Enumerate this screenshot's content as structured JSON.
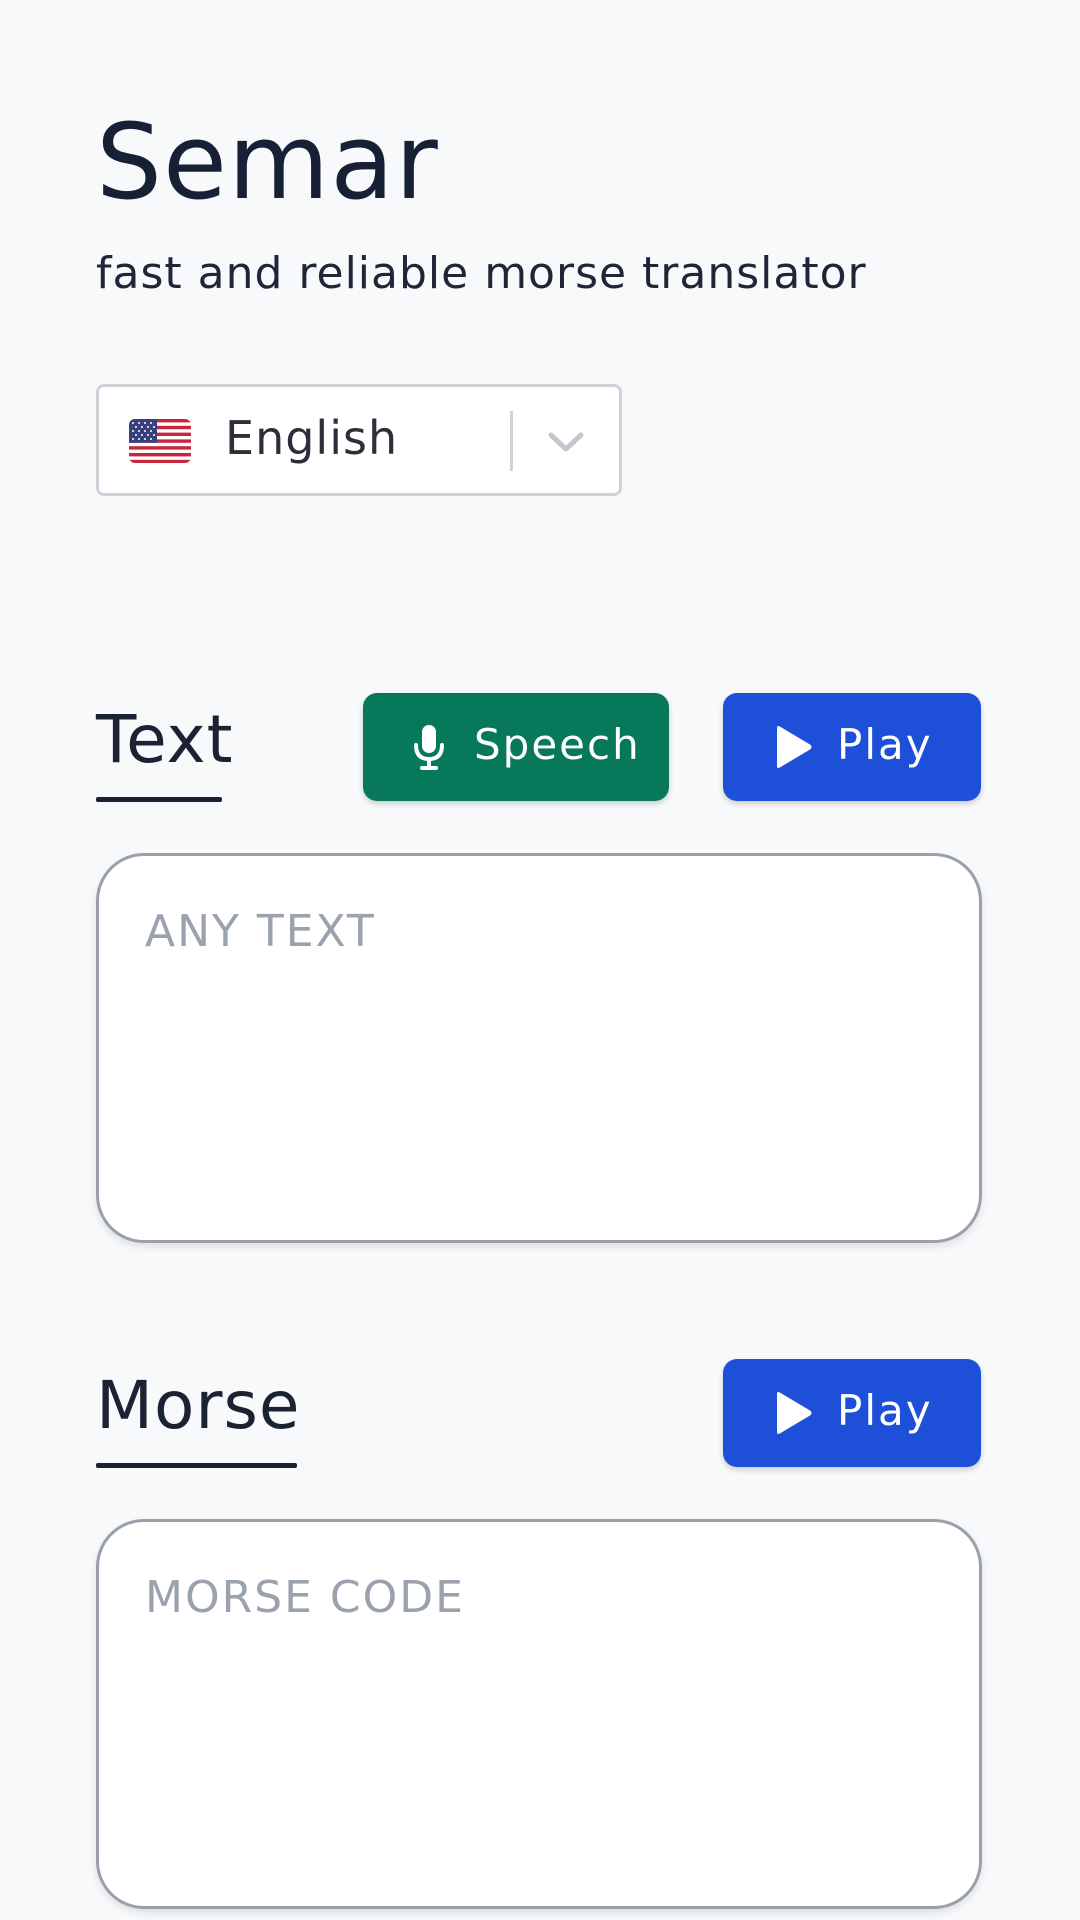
{
  "app": {
    "title": "Semar",
    "subtitle": "fast and reliable morse translator"
  },
  "language": {
    "selected": "English",
    "flag_icon": "us-flag-icon"
  },
  "text_section": {
    "title": "Text",
    "speech_label": "Speech",
    "play_label": "Play",
    "placeholder": "ANY TEXT",
    "value": ""
  },
  "morse_section": {
    "title": "Morse",
    "play_label": "Play",
    "placeholder": "MORSE CODE",
    "value": ""
  },
  "colors": {
    "background": "#f8f9fb",
    "speech_button": "#07795a",
    "play_button": "#1d4fd8",
    "text": "#1a2233",
    "placeholder": "#9aa2ae"
  }
}
